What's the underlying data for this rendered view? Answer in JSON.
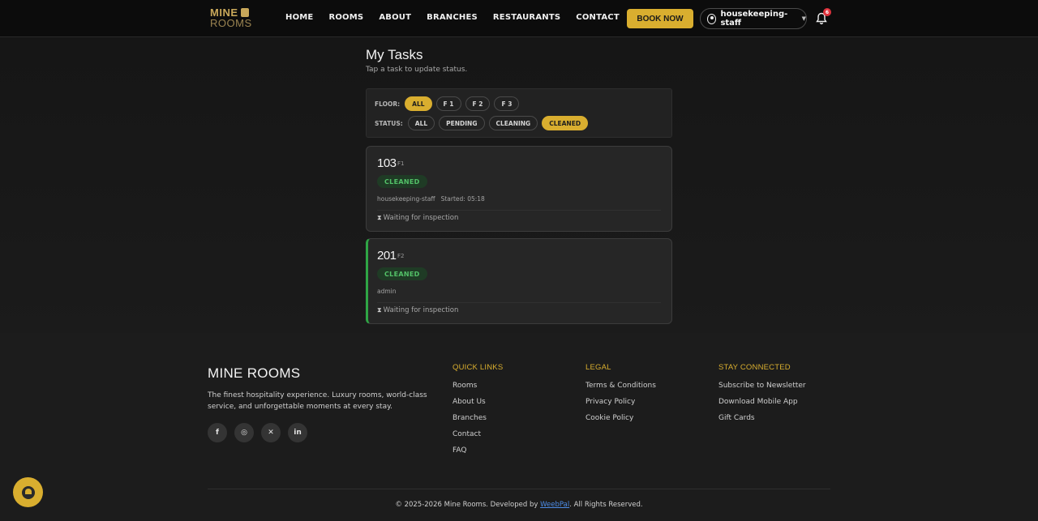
{
  "brand": {
    "line1": "MINE",
    "line2": "ROOMS"
  },
  "nav": {
    "items": [
      "HOME",
      "ROOMS",
      "ABOUT",
      "BRANCHES",
      "RESTAURANTS",
      "CONTACT"
    ],
    "book_label": "BOOK NOW",
    "user": "housekeeping-staff",
    "notification_count": "6"
  },
  "page": {
    "title": "My Tasks",
    "subtitle": "Tap a task to update status."
  },
  "filters": {
    "floor_label": "FLOOR:",
    "floor_options": [
      "ALL",
      "F 1",
      "F 2",
      "F 3"
    ],
    "floor_selected": "ALL",
    "status_label": "STATUS:",
    "status_options": [
      "ALL",
      "PENDING",
      "CLEANING",
      "CLEANED"
    ],
    "status_selected": "CLEANED"
  },
  "tasks": [
    {
      "room": "103",
      "floor": "F1",
      "status": "CLEANED",
      "assignee": "housekeeping-staff",
      "started": "Started: 05:18",
      "note": "Waiting for inspection"
    },
    {
      "room": "201",
      "floor": "F2",
      "status": "CLEANED",
      "assignee": "admin",
      "started": "",
      "note": "Waiting for inspection"
    }
  ],
  "footer": {
    "brand": "MINE ROOMS",
    "description": "The finest hospitality experience. Luxury rooms, world-class service, and unforgettable moments at every stay.",
    "quick_links_title": "QUICK LINKS",
    "quick_links": [
      "Rooms",
      "About Us",
      "Branches",
      "Contact",
      "FAQ"
    ],
    "legal_title": "LEGAL",
    "legal": [
      "Terms & Conditions",
      "Privacy Policy",
      "Cookie Policy"
    ],
    "connected_title": "STAY CONNECTED",
    "connected": [
      "Subscribe to Newsletter",
      "Download Mobile App",
      "Gift Cards"
    ],
    "copyright_pre": "© 2025-2026 Mine Rooms. Developed by ",
    "copyright_link": "WeebPal",
    "copyright_post": ". All Rights Reserved."
  },
  "colors": {
    "accent": "#d9ae2f",
    "success": "#53c168",
    "background": "#151515"
  },
  "icons": {
    "bell": "bell-icon",
    "user": "user-circle-icon",
    "hourglass": "hourglass-icon"
  }
}
